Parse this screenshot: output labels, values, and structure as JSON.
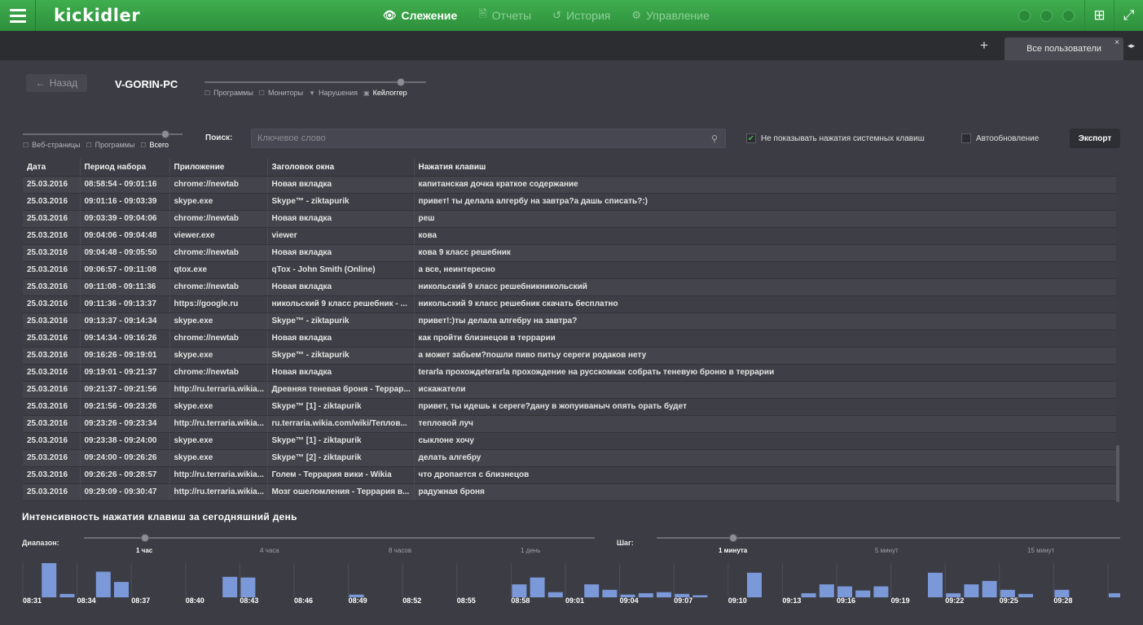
{
  "topbar": {
    "logo": "kickidler",
    "nav": [
      {
        "label": "Слежение",
        "icon": "eye-icon",
        "active": true
      },
      {
        "label": "Отчеты",
        "icon": "document-icon",
        "active": false
      },
      {
        "label": "История",
        "icon": "history-icon",
        "active": false
      },
      {
        "label": "Управление",
        "icon": "gear-icon",
        "active": false
      }
    ]
  },
  "tabs": {
    "add": "+",
    "active_tab": "Все пользователи",
    "close": "×",
    "arrows": "◂▸"
  },
  "header": {
    "back_label": "Назад",
    "back_icon": "←",
    "pc_name": "V-GORIN-PC"
  },
  "view_filters": [
    {
      "label": "Программы",
      "active": false
    },
    {
      "label": "Мониторы",
      "active": false
    },
    {
      "label": "Нарушения",
      "active": false
    },
    {
      "label": "Кейлоггер",
      "active": true
    }
  ],
  "source_filters": [
    {
      "label": "Веб-страницы",
      "active": false
    },
    {
      "label": "Программы",
      "active": false
    },
    {
      "label": "Всего",
      "active": true
    }
  ],
  "search": {
    "label": "Поиск:",
    "placeholder": "Ключевое слово"
  },
  "options": {
    "hide_system_keys": {
      "label": "Не показывать нажатия системных клавиш",
      "checked": true
    },
    "auto_refresh": {
      "label": "Автообновление",
      "checked": false
    }
  },
  "export_label": "Экспорт",
  "table": {
    "columns": [
      "Дата",
      "Период набора",
      "Приложение",
      "Заголовок окна",
      "Нажатия клавиш"
    ],
    "rows": [
      [
        "25.03.2016",
        "08:58:54 - 09:01:16",
        "chrome://newtab",
        "Новая вкладка",
        "капитанская дочка краткое содержание"
      ],
      [
        "25.03.2016",
        "09:01:16 - 09:03:39",
        "skype.exe",
        "Skype™ - ziktapurik",
        "привет! ты делала алгербу на завтра?а дашь списать?:)"
      ],
      [
        "25.03.2016",
        "09:03:39 - 09:04:06",
        "chrome://newtab",
        "Новая вкладка",
        "реш"
      ],
      [
        "25.03.2016",
        "09:04:06 - 09:04:48",
        "viewer.exe",
        "viewer",
        "кова"
      ],
      [
        "25.03.2016",
        "09:04:48 - 09:05:50",
        "chrome://newtab",
        "Новая вкладка",
        "кова 9 класс решебник"
      ],
      [
        "25.03.2016",
        "09:06:57 - 09:11:08",
        "qtox.exe",
        "qTox - John Smith (Online)",
        "а все, неинтересно"
      ],
      [
        "25.03.2016",
        "09:11:08 - 09:11:36",
        "chrome://newtab",
        "Новая вкладка",
        "никольский 9 класс решебникникольский"
      ],
      [
        "25.03.2016",
        "09:11:36 - 09:13:37",
        "https://google.ru",
        "никольский 9 класс решебник - ...",
        "никольский 9 класс решебник скачать бесплатно"
      ],
      [
        "25.03.2016",
        "09:13:37 - 09:14:34",
        "skype.exe",
        "Skype™ - ziktapurik",
        "привет!:)ты делала алгебру на завтра?"
      ],
      [
        "25.03.2016",
        "09:14:34 - 09:16:26",
        "chrome://newtab",
        "Новая вкладка",
        "как пройти близнецов в террарии"
      ],
      [
        "25.03.2016",
        "09:16:26 - 09:19:01",
        "skype.exe",
        "Skype™ - ziktapurik",
        "а может забьем?пошли пиво питьу сереги родаков нету"
      ],
      [
        "25.03.2016",
        "09:19:01 - 09:21:37",
        "chrome://newtab",
        "Новая вкладка",
        "terarla прохождeterarla прохождение на русскомкак собрать теневую броню в террарии"
      ],
      [
        "25.03.2016",
        "09:21:37 - 09:21:56",
        "http://ru.terraria.wikia...",
        "Древняя теневая броня - Террар...",
        "искажатели"
      ],
      [
        "25.03.2016",
        "09:21:56 - 09:23:26",
        "skype.exe",
        "Skype™ [1] - ziktapurik",
        "привет, ты идешь к сереге?дану в жопуиваныч опять орать будет"
      ],
      [
        "25.03.2016",
        "09:23:26 - 09:23:34",
        "http://ru.terraria.wikia...",
        "ru.terraria.wikia.com/wiki/Теплов...",
        "тепловой луч"
      ],
      [
        "25.03.2016",
        "09:23:38 - 09:24:00",
        "skype.exe",
        "Skype™ [1] - ziktapurik",
        "сыклоне хочу"
      ],
      [
        "25.03.2016",
        "09:24:00 - 09:26:26",
        "skype.exe",
        "Skype™ [2] - ziktapurik",
        "делать алгебру"
      ],
      [
        "25.03.2016",
        "09:26:26 - 09:28:57",
        "http://ru.terraria.wikia...",
        "Голем - Террария вики - Wikia",
        "что дропается с близнецов"
      ],
      [
        "25.03.2016",
        "09:29:09 - 09:30:47",
        "http://ru.terraria.wikia...",
        "Мозг ошеломления - Террария в...",
        "радужная броня"
      ]
    ]
  },
  "intensity": {
    "title": "Интенсивность нажатия клавиш за сегодняшний день",
    "range_label": "Диапазон:",
    "range_ticks": [
      {
        "label": "1 час",
        "active": true
      },
      {
        "label": "4 часа",
        "active": false
      },
      {
        "label": "8 часов",
        "active": false
      },
      {
        "label": "1 день",
        "active": false
      }
    ],
    "step_label": "Шаг:",
    "step_ticks": [
      {
        "label": "1 минута",
        "active": true
      },
      {
        "label": "5 минут",
        "active": false
      },
      {
        "label": "15 минут",
        "active": false
      }
    ]
  },
  "chart_data": {
    "type": "bar",
    "bar_color": "#7b98d9",
    "tick_labels": [
      "08:31",
      "08:34",
      "08:37",
      "08:40",
      "08:43",
      "08:46",
      "08:49",
      "08:52",
      "08:55",
      "08:58",
      "09:01",
      "09:04",
      "09:07",
      "09:10",
      "09:13",
      "09:16",
      "09:19",
      "09:22",
      "09:25",
      "09:28"
    ],
    "values": [
      0,
      1.0,
      0.1,
      0,
      0.75,
      0.45,
      0,
      0,
      0,
      0,
      0,
      0.6,
      0.58,
      0,
      0,
      0,
      0,
      0,
      0.08,
      0,
      0,
      0,
      0,
      0,
      0,
      0,
      0,
      0.38,
      0.58,
      0.15,
      0,
      0.38,
      0.22,
      0.08,
      0.12,
      0.15,
      0.1,
      0.06,
      0,
      0,
      0.72,
      0,
      0,
      0.12,
      0.38,
      0.32,
      0.2,
      0.32,
      0,
      0,
      0.72,
      0.12,
      0.38,
      0.48,
      0.22,
      0.1,
      0,
      0.22,
      0,
      0,
      0.12,
      0.03,
      0.03
    ]
  }
}
